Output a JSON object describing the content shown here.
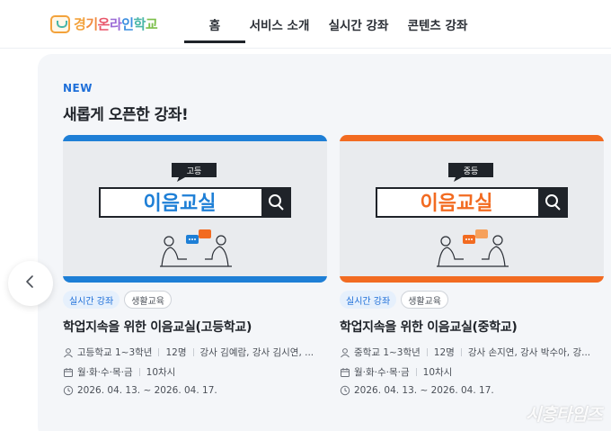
{
  "header": {
    "logo": {
      "text": "경기온라인학교",
      "letter_colors": [
        "#f3a23b",
        "#f08a3e",
        "#e8566a",
        "#9b6bd6",
        "#3c8fe0",
        "#49b6a8",
        "#7cbf4a"
      ]
    },
    "nav": [
      {
        "label": "홈",
        "active": true
      },
      {
        "label": "서비스 소개",
        "active": false
      },
      {
        "label": "실시간 강좌",
        "active": false
      },
      {
        "label": "콘텐츠 강좌",
        "active": false
      }
    ]
  },
  "section": {
    "badge": "NEW",
    "title": "새롭게 오픈한 강좌!"
  },
  "prev_button_icon": "chevron-left-icon",
  "cards": [
    {
      "thumb": {
        "level": "고등",
        "banner": "이음교실",
        "accent": "#1e7fd6"
      },
      "tags": [
        "실시간 강좌",
        "생활교육"
      ],
      "title": "학업지속을 위한 이음교실(고등학교)",
      "audience": "고등학교 1~3학년",
      "capacity": "12명",
      "teachers": "강사 김예람, 강사 김시연, ...",
      "days": "월·화·수·목·금",
      "sessions": "10차시",
      "period": "2026. 04. 13. ~ 2026. 04. 17."
    },
    {
      "thumb": {
        "level": "중등",
        "banner": "이음교실",
        "accent": "#f26b21"
      },
      "tags": [
        "실시간 강좌",
        "생활교육"
      ],
      "title": "학업지속을 위한 이음교실(중학교)",
      "audience": "중학교 1~3학년",
      "capacity": "12명",
      "teachers": "강사 손지연, 강사 박수아, 강...",
      "days": "월·화·수·목·금",
      "sessions": "10차시",
      "period": "2026. 04. 13. ~ 2026. 04. 17."
    }
  ],
  "watermark": "시흥타임즈"
}
